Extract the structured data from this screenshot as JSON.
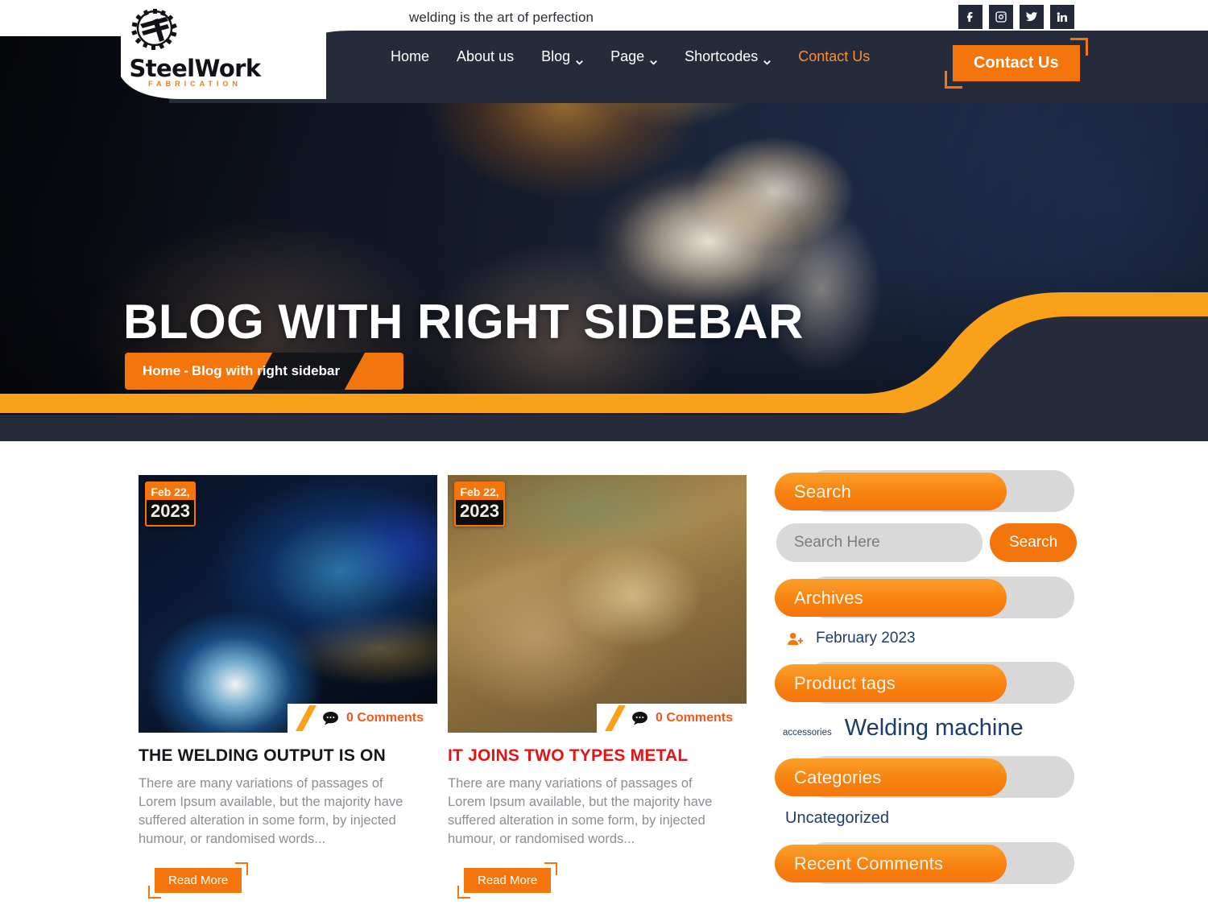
{
  "topbar": {
    "tagline": "welding is the art of perfection",
    "socials": [
      {
        "name": "facebook-icon",
        "label": "Facebook"
      },
      {
        "name": "instagram-icon",
        "label": "Instagram"
      },
      {
        "name": "twitter-icon",
        "label": "Twitter"
      },
      {
        "name": "linkedin-icon",
        "label": "LinkedIn"
      }
    ]
  },
  "logo": {
    "name": "SteelWork",
    "sub": "FABRICATION"
  },
  "nav": {
    "items": [
      {
        "label": "Home",
        "has_caret": false,
        "active": false
      },
      {
        "label": "About us",
        "has_caret": false,
        "active": false
      },
      {
        "label": "Blog",
        "has_caret": true,
        "active": false
      },
      {
        "label": "Page",
        "has_caret": true,
        "active": false
      },
      {
        "label": "Shortcodes",
        "has_caret": true,
        "active": false
      },
      {
        "label": "Contact Us",
        "has_caret": false,
        "active": true
      }
    ],
    "cta_label": "Contact Us"
  },
  "hero": {
    "title": "BLOG WITH RIGHT SIDEBAR",
    "breadcrumb_home": "Home",
    "breadcrumb_sep": "-",
    "breadcrumb_current": "Blog with right sidebar"
  },
  "posts": [
    {
      "date_month_day": "Feb 22,",
      "date_year": "2023",
      "comments": "0 Comments",
      "title": "THE WELDING OUTPUT IS ON",
      "excerpt": "There are many variations of passages of Lorem Ipsum available, but the majority have suffered alteration in some form, by injected humour, or randomised words...",
      "read_more": "Read More",
      "title_highlight": false
    },
    {
      "date_month_day": "Feb 22,",
      "date_year": "2023",
      "comments": "0 Comments",
      "title": "IT JOINS TWO TYPES METAL",
      "excerpt": "There are many variations of passages of Lorem Ipsum available, but the majority have suffered alteration in some form, by injected humour, or randomised words...",
      "read_more": "Read More",
      "title_highlight": true
    }
  ],
  "sidebar": {
    "search": {
      "heading": "Search",
      "placeholder": "Search Here",
      "button": "Search"
    },
    "archives": {
      "heading": "Archives",
      "items": [
        {
          "label": "February 2023",
          "icon": "user-plus-icon"
        }
      ]
    },
    "product_tags": {
      "heading": "Product tags",
      "tags": [
        {
          "label": "accessories",
          "size": "small"
        },
        {
          "label": "Welding machine",
          "size": "large"
        }
      ]
    },
    "categories": {
      "heading": "Categories",
      "items": [
        "Uncategorized"
      ]
    },
    "recent_comments": {
      "heading": "Recent Comments"
    }
  },
  "colors": {
    "accent_orange": "#f5750d",
    "accent_orange_light": "#f9a11b",
    "dark_navy": "#252b3a",
    "link_blue": "#1d3c6b",
    "highlight_red": "#e21414"
  }
}
